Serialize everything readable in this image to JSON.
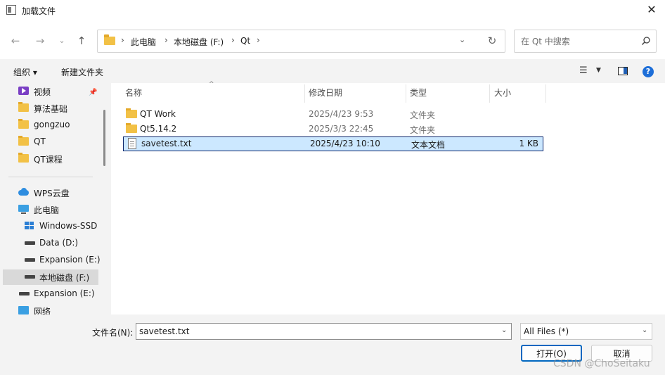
{
  "window": {
    "title": "加载文件"
  },
  "address": {
    "crumbs": [
      "此电脑",
      "本地磁盘 (F:)",
      "Qt"
    ]
  },
  "search": {
    "placeholder": "在 Qt 中搜索"
  },
  "toolbar": {
    "organize_label": "组织 ▾",
    "new_folder_label": "新建文件夹"
  },
  "sidebar": {
    "items": [
      {
        "label": "视频",
        "icon": "video-icon"
      },
      {
        "label": "算法基础",
        "icon": "folder-icon"
      },
      {
        "label": "gongzuo",
        "icon": "folder-icon"
      },
      {
        "label": "QT",
        "icon": "folder-icon"
      },
      {
        "label": "QT课程",
        "icon": "folder-icon"
      },
      {
        "label": "WPS云盘",
        "icon": "cloud-icon"
      },
      {
        "label": "此电脑",
        "icon": "pc-icon"
      },
      {
        "label": "Windows-SSD",
        "icon": "windows-drive-icon"
      },
      {
        "label": "Data (D:)",
        "icon": "drive-icon"
      },
      {
        "label": "Expansion (E:)",
        "icon": "drive-icon"
      },
      {
        "label": "本地磁盘 (F:)",
        "icon": "drive-icon"
      },
      {
        "label": "Expansion (E:)",
        "icon": "drive-icon"
      },
      {
        "label": "网络",
        "icon": "network-icon"
      }
    ]
  },
  "files": {
    "columns": [
      "名称",
      "修改日期",
      "类型",
      "大小"
    ],
    "rows": [
      {
        "name": "QT Work",
        "date": "2025/4/23 9:53",
        "type": "文件夹",
        "size": ""
      },
      {
        "name": "Qt5.14.2",
        "date": "2025/3/3 22:45",
        "type": "文件夹",
        "size": ""
      },
      {
        "name": "savetest.txt",
        "date": "2025/4/23 10:10",
        "type": "文本文档",
        "size": "1 KB"
      }
    ]
  },
  "bottom": {
    "filename_label": "文件名(N):",
    "filename_value": "savetest.txt",
    "filetype_value": "All Files  (*)",
    "open_label": "打开(O)",
    "cancel_label": "取消"
  },
  "watermark": "CSDN @ChoSeitaku",
  "colors": {
    "accent": "#0067c0",
    "selection": "#cce8ff",
    "folder": "#f2c146"
  }
}
